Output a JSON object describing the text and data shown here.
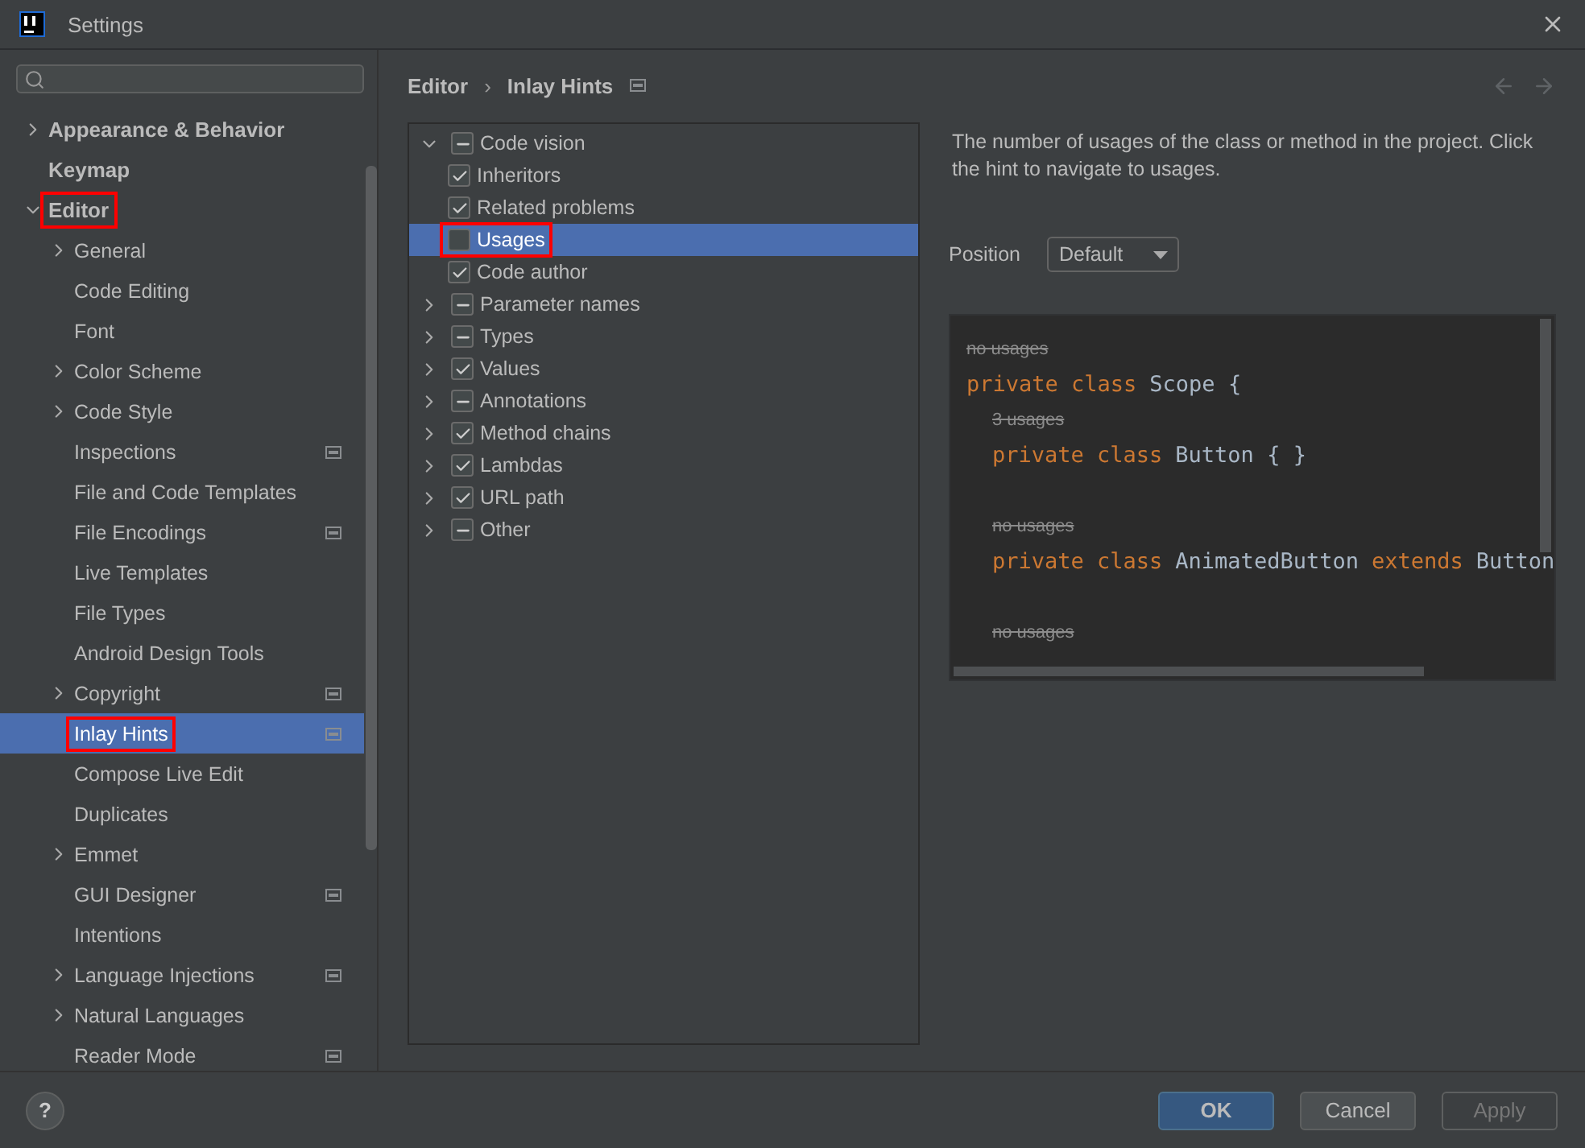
{
  "window": {
    "title": "Settings"
  },
  "search": {
    "kind": "empty"
  },
  "sidebar": {
    "items": [
      {
        "label": "Appearance & Behavior",
        "expanded": false,
        "bold": true,
        "selected": false,
        "highlighted": false
      },
      {
        "label": "Keymap",
        "bold": true,
        "selected": false,
        "highlighted": false
      },
      {
        "label": "Editor",
        "expanded": true,
        "bold": true,
        "selected": false,
        "highlighted": true,
        "children": [
          {
            "label": "General",
            "expanded": false,
            "selected": false,
            "highlighted": false
          },
          {
            "label": "Code Editing",
            "selected": false,
            "highlighted": false
          },
          {
            "label": "Font",
            "selected": false,
            "highlighted": false
          },
          {
            "label": "Color Scheme",
            "expanded": false,
            "selected": false,
            "highlighted": false
          },
          {
            "label": "Code Style",
            "expanded": false,
            "selected": false,
            "highlighted": false
          },
          {
            "label": "Inspections",
            "project": true,
            "selected": false,
            "highlighted": false
          },
          {
            "label": "File and Code Templates",
            "selected": false,
            "highlighted": false
          },
          {
            "label": "File Encodings",
            "project": true,
            "selected": false,
            "highlighted": false
          },
          {
            "label": "Live Templates",
            "selected": false,
            "highlighted": false
          },
          {
            "label": "File Types",
            "selected": false,
            "highlighted": false
          },
          {
            "label": "Android Design Tools",
            "selected": false,
            "highlighted": false
          },
          {
            "label": "Copyright",
            "expanded": false,
            "project": true,
            "selected": false,
            "highlighted": false
          },
          {
            "label": "Inlay Hints",
            "project": true,
            "selected": true,
            "highlighted": true
          },
          {
            "label": "Compose Live Edit",
            "selected": false,
            "highlighted": false
          },
          {
            "label": "Duplicates",
            "selected": false,
            "highlighted": false
          },
          {
            "label": "Emmet",
            "expanded": false,
            "selected": false,
            "highlighted": false
          },
          {
            "label": "GUI Designer",
            "project": true,
            "selected": false,
            "highlighted": false
          },
          {
            "label": "Intentions",
            "selected": false,
            "highlighted": false
          },
          {
            "label": "Language Injections",
            "expanded": false,
            "project": true,
            "selected": false,
            "highlighted": false
          },
          {
            "label": "Natural Languages",
            "expanded": false,
            "selected": false,
            "highlighted": false
          },
          {
            "label": "Reader Mode",
            "project": true,
            "selected": false,
            "highlighted": false
          }
        ]
      }
    ]
  },
  "breadcrumb": {
    "parent": "Editor",
    "separator": "›",
    "current": "Inlay Hints"
  },
  "hints_tree": [
    {
      "label": "Code vision",
      "expanded": true,
      "checked": true,
      "mixed": true,
      "selected": false,
      "highlighted": false,
      "children": [
        {
          "label": "Inheritors",
          "checked": true,
          "mixed": false,
          "selected": false,
          "highlighted": false
        },
        {
          "label": "Related problems",
          "checked": true,
          "mixed": false,
          "selected": false,
          "highlighted": false
        },
        {
          "label": "Usages",
          "checked": false,
          "mixed": false,
          "selected": true,
          "highlighted": true
        },
        {
          "label": "Code author",
          "checked": true,
          "mixed": false,
          "selected": false,
          "highlighted": false
        }
      ]
    },
    {
      "label": "Parameter names",
      "expanded": false,
      "checked": true,
      "mixed": true,
      "selected": false,
      "highlighted": false
    },
    {
      "label": "Types",
      "expanded": false,
      "checked": true,
      "mixed": true,
      "selected": false,
      "highlighted": false
    },
    {
      "label": "Values",
      "expanded": false,
      "checked": true,
      "mixed": false,
      "selected": false,
      "highlighted": false
    },
    {
      "label": "Annotations",
      "expanded": false,
      "checked": true,
      "mixed": true,
      "selected": false,
      "highlighted": false
    },
    {
      "label": "Method chains",
      "expanded": false,
      "checked": true,
      "mixed": false,
      "selected": false,
      "highlighted": false
    },
    {
      "label": "Lambdas",
      "expanded": false,
      "checked": true,
      "mixed": false,
      "selected": false,
      "highlighted": false
    },
    {
      "label": "URL path",
      "expanded": false,
      "checked": true,
      "mixed": false,
      "selected": false,
      "highlighted": false
    },
    {
      "label": "Other",
      "expanded": false,
      "checked": true,
      "mixed": true,
      "selected": false,
      "highlighted": false
    }
  ],
  "description": "The number of usages of the class or method in the project. Click the hint to navigate to usages.",
  "position": {
    "label": "Position",
    "value": "Default"
  },
  "preview": {
    "lines": [
      {
        "kind": "hint",
        "text": "no usages"
      },
      {
        "kind": "code",
        "tokens": [
          {
            "kind": "keyword",
            "text": "private class"
          },
          {
            "kind": "plain",
            "text": "Scope {"
          }
        ],
        "children": [
          {
            "kind": "hint",
            "text": "3 usages"
          },
          {
            "kind": "code",
            "tokens": [
              {
                "kind": "keyword",
                "text": "private class"
              },
              {
                "kind": "plain",
                "text": "Button { }"
              }
            ]
          },
          {
            "kind": "blank"
          },
          {
            "kind": "hint",
            "text": "no usages"
          },
          {
            "kind": "code",
            "tokens": [
              {
                "kind": "keyword",
                "text": "private class"
              },
              {
                "kind": "plain",
                "text": "AnimatedButton"
              },
              {
                "kind": "keyword",
                "text": "extends"
              },
              {
                "kind": "plain",
                "text": "Button"
              }
            ]
          },
          {
            "kind": "blank"
          },
          {
            "kind": "hint",
            "text": "no usages"
          }
        ]
      }
    ]
  },
  "help": "?",
  "buttons": [
    {
      "label": "OK",
      "kind": "primary",
      "disabled": false
    },
    {
      "label": "Cancel",
      "kind": "normal",
      "disabled": false
    },
    {
      "label": "Apply",
      "kind": "normal",
      "disabled": true
    }
  ]
}
